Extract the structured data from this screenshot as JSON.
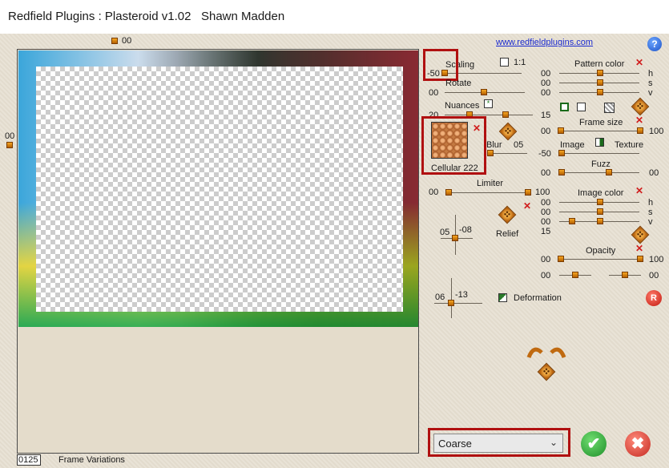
{
  "window": {
    "title": "Redfield Plugins : Plasteroid v1.02   Shawn Madden"
  },
  "header": {
    "link": "www.redfieldplugins.com",
    "help_label": "?"
  },
  "preview": {
    "top_value": "00",
    "left_value": "00"
  },
  "scaling": {
    "label": "Scaling",
    "value": "-50",
    "checkbox_label": "1:1"
  },
  "rotate": {
    "label": "Rotate",
    "value": "00"
  },
  "nuances": {
    "label": "Nuances",
    "value_left": "20",
    "value_right": "15"
  },
  "texture_thumb": {
    "label": "Cellular 222"
  },
  "blur": {
    "label": "Blur",
    "value": "05"
  },
  "limiter": {
    "label": "Limiter",
    "value_left": "00",
    "value_right": "100"
  },
  "relief": {
    "label": "Relief",
    "x": "05",
    "y": "-08"
  },
  "deformation": {
    "label": "Deformation",
    "x": "06",
    "y": "-13"
  },
  "pattern_color": {
    "label": "Pattern color",
    "rows": [
      {
        "value": "00",
        "channel": "h"
      },
      {
        "value": "00",
        "channel": "s"
      },
      {
        "value": "00",
        "channel": "v"
      }
    ]
  },
  "frame_size": {
    "label": "Frame size",
    "value_left": "00",
    "value_right": "100"
  },
  "image_texture": {
    "label_left": "Image",
    "label_right": "Texture",
    "value": "-50"
  },
  "fuzz": {
    "label": "Fuzz",
    "value_left": "00",
    "value_right": "00"
  },
  "image_color": {
    "label": "Image color",
    "rows": [
      {
        "value": "00",
        "channel": "h"
      },
      {
        "value": "00",
        "channel": "s"
      },
      {
        "value": "00",
        "channel": "v"
      }
    ],
    "extra": "15"
  },
  "opacity": {
    "label": "Opacity",
    "value_left": "00",
    "value_right": "100",
    "row2_left": "00",
    "row2_right": "00"
  },
  "reset_label": "R",
  "quality": {
    "selected": "Coarse"
  },
  "footer": {
    "frame_number": "0125",
    "frame_label": "Frame Variations"
  },
  "colors": {
    "accent_red": "#b01010",
    "handle_orange": "#e08a1a",
    "ok_green": "#2fa83a",
    "cancel_red": "#d2332b"
  }
}
